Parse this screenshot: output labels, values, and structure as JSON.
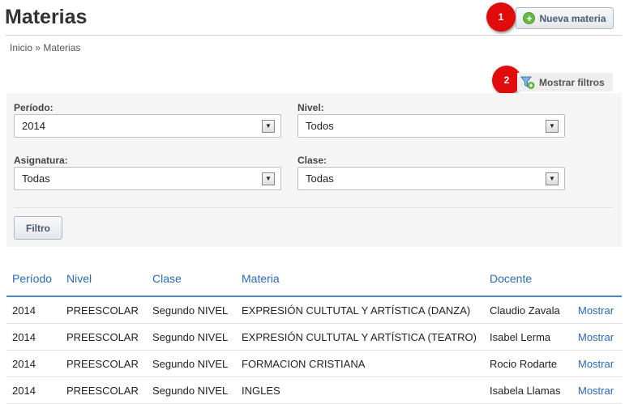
{
  "header": {
    "title": "Materias",
    "new_button_label": "Nueva materia",
    "breadcrumb": "Inicio » Materias"
  },
  "markers": [
    "1",
    "2"
  ],
  "filters_toggle_label": "Mostrar filtros",
  "filters": {
    "periodo": {
      "label": "Período:",
      "value": "2014"
    },
    "nivel": {
      "label": "Nivel:",
      "value": "Todos"
    },
    "asignatura": {
      "label": "Asignatura:",
      "value": "Todas"
    },
    "clase": {
      "label": "Clase:",
      "value": "Todas"
    },
    "submit_label": "Filtro"
  },
  "table": {
    "headers": [
      "Período",
      "Nivel",
      "Clase",
      "Materia",
      "Docente",
      ""
    ],
    "rows": [
      [
        "2014",
        "PREESCOLAR",
        "Segundo NIVEL",
        "EXPRESIÓN CULTUTAL Y ARTÍSTICA (DANZA)",
        "Claudio Zavala",
        "Mostrar"
      ],
      [
        "2014",
        "PREESCOLAR",
        "Segundo NIVEL",
        "EXPRESIÓN CULTUTAL Y ARTÍSTICA (TEATRO)",
        "Isabel Lerma",
        "Mostrar"
      ],
      [
        "2014",
        "PREESCOLAR",
        "Segundo NIVEL",
        "FORMACION CRISTIANA",
        "Rocio Rodarte",
        "Mostrar"
      ],
      [
        "2014",
        "PREESCOLAR",
        "Segundo NIVEL",
        "INGLES",
        "Isabela Llamas",
        "Mostrar"
      ]
    ]
  },
  "colors": {
    "accent_link": "#2a6ab8",
    "marker": "#e10b0b",
    "add_icon": "#6bb844"
  },
  "icons": {
    "new_button": "plus-circle-icon",
    "filters": "funnel-icon",
    "select": "chevron-down-icon"
  }
}
